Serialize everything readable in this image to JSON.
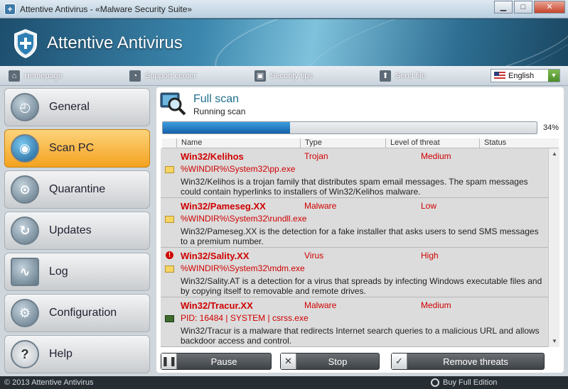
{
  "window": {
    "title": "Attentive Antivirus - «Malware Security Suite»"
  },
  "banner": {
    "brand": "Attentive Antivirus"
  },
  "nav": [
    {
      "label": "Homepage",
      "icon": "home-icon"
    },
    {
      "label": "Support center",
      "icon": "rss-icon"
    },
    {
      "label": "Security tips",
      "icon": "lock-icon"
    },
    {
      "label": "Send file",
      "icon": "upload-icon"
    }
  ],
  "language": {
    "selected": "English"
  },
  "sidebar": {
    "items": [
      {
        "label": "General",
        "icon": "dashboard-icon",
        "active": false
      },
      {
        "label": "Scan PC",
        "icon": "scan-icon",
        "active": true
      },
      {
        "label": "Quarantine",
        "icon": "padlock-icon",
        "active": false
      },
      {
        "label": "Updates",
        "icon": "refresh-icon",
        "active": false
      },
      {
        "label": "Log",
        "icon": "monitor-icon",
        "active": false
      },
      {
        "label": "Configuration",
        "icon": "gear-icon",
        "active": false
      },
      {
        "label": "Help",
        "icon": "help-icon",
        "active": false
      }
    ]
  },
  "scan": {
    "title": "Full scan",
    "subtitle": "Running scan",
    "progress_label": "34%",
    "progress_value": 0.34
  },
  "table": {
    "columns": [
      "Name",
      "Type",
      "Level of threat",
      "Status"
    ],
    "rows": [
      {
        "name": "Win32/Kelihos",
        "type": "Trojan",
        "level": "Medium",
        "path": "%WINDIR%\\System32\\pp.exe",
        "desc": "Win32/Kelihos is a trojan family that distributes spam email messages. The spam messages could contain hyperlinks to installers of Win32/Kelihos malware."
      },
      {
        "name": "Win32/Pameseg.XX",
        "type": "Malware",
        "level": "Low",
        "path": "%WINDIR%\\System32\\rundll.exe",
        "desc": "Win32/Pameseg.XX is the detection for a fake installer that asks users to send SMS messages to a premium number."
      },
      {
        "name": "Win32/Sality.XX",
        "type": "Virus",
        "level": "High",
        "path": "%WINDIR%\\System32\\mdm.exe",
        "desc": "Win32/Sality.AT is a detection for a virus that spreads by infecting Windows executable files and by copying itself to removable and remote drives."
      },
      {
        "name": "Win32/Tracur.XX",
        "type": "Malware",
        "level": "Medium",
        "path": "PID: 16484 | SYSTEM | csrss.exe",
        "desc": "Win32/Tracur is a malware that redirects Internet search queries to a malicious URL and allows backdoor access and control."
      }
    ]
  },
  "buttons": {
    "pause": "Pause",
    "stop": "Stop",
    "remove": "Remove threats"
  },
  "footer": {
    "copyright": "© 2013 Attentive Antivirus",
    "buy": "Buy Full Edition"
  },
  "colors": {
    "threat_red": "#d00000",
    "active_tab": "#f3a21f",
    "progress": "#1f6fbf"
  }
}
